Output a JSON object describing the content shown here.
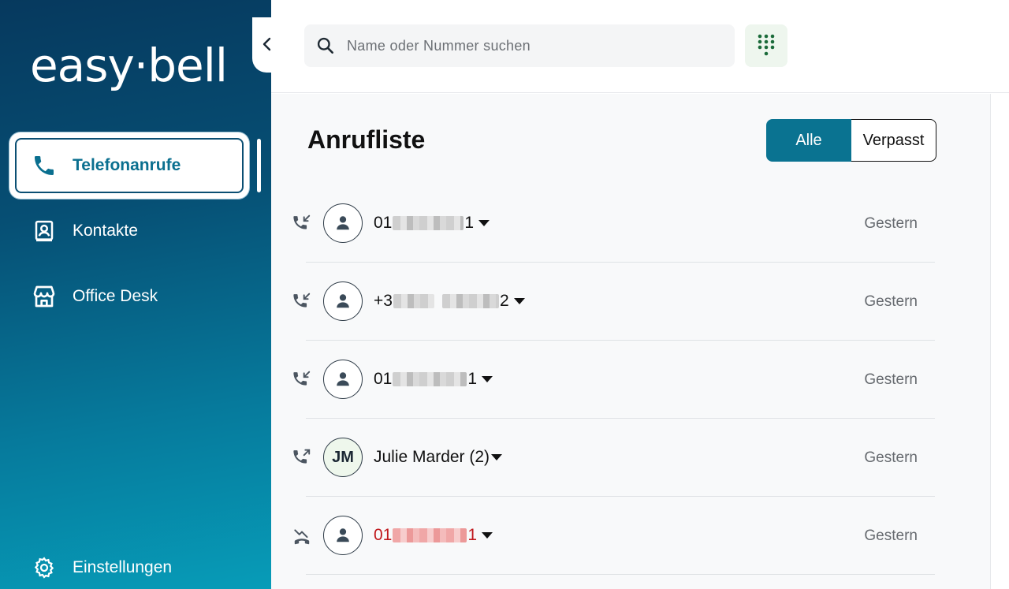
{
  "app": {
    "logo_text": "easy·bell"
  },
  "sidebar": {
    "items": [
      {
        "label": "Telefonanrufe",
        "icon": "phone-icon",
        "active": true
      },
      {
        "label": "Kontakte",
        "icon": "contact-book-icon",
        "active": false
      },
      {
        "label": "Office Desk",
        "icon": "store-icon",
        "active": false
      }
    ],
    "settings_label": "Einstellungen"
  },
  "search": {
    "placeholder": "Name oder Nummer suchen",
    "value": ""
  },
  "page": {
    "title": "Anrufliste"
  },
  "filter": {
    "all_label": "Alle",
    "missed_label": "Verpasst",
    "selected": "Alle"
  },
  "calls": [
    {
      "type": "incoming",
      "avatar": "person-icon",
      "prefix": "01",
      "suffix": "1",
      "time": "Gestern",
      "missed": false
    },
    {
      "type": "incoming",
      "avatar": "person-icon",
      "prefix": "+3",
      "suffix": "2",
      "time": "Gestern",
      "missed": false
    },
    {
      "type": "incoming",
      "avatar": "person-icon",
      "prefix": "01",
      "suffix": "1",
      "time": "Gestern",
      "missed": false
    },
    {
      "type": "outgoing",
      "avatar_initials": "JM",
      "name": "Julie Marder (2)",
      "time": "Gestern",
      "missed": false
    },
    {
      "type": "missed",
      "avatar": "person-icon",
      "prefix": "01",
      "suffix": "1",
      "time": "Gestern",
      "missed": true
    }
  ],
  "colors": {
    "accent": "#0a7391",
    "sidebar_top": "#06395e",
    "sidebar_bottom": "#079cb8",
    "missed_red": "#c0181c",
    "dialpad_green": "#1b6b3a"
  }
}
